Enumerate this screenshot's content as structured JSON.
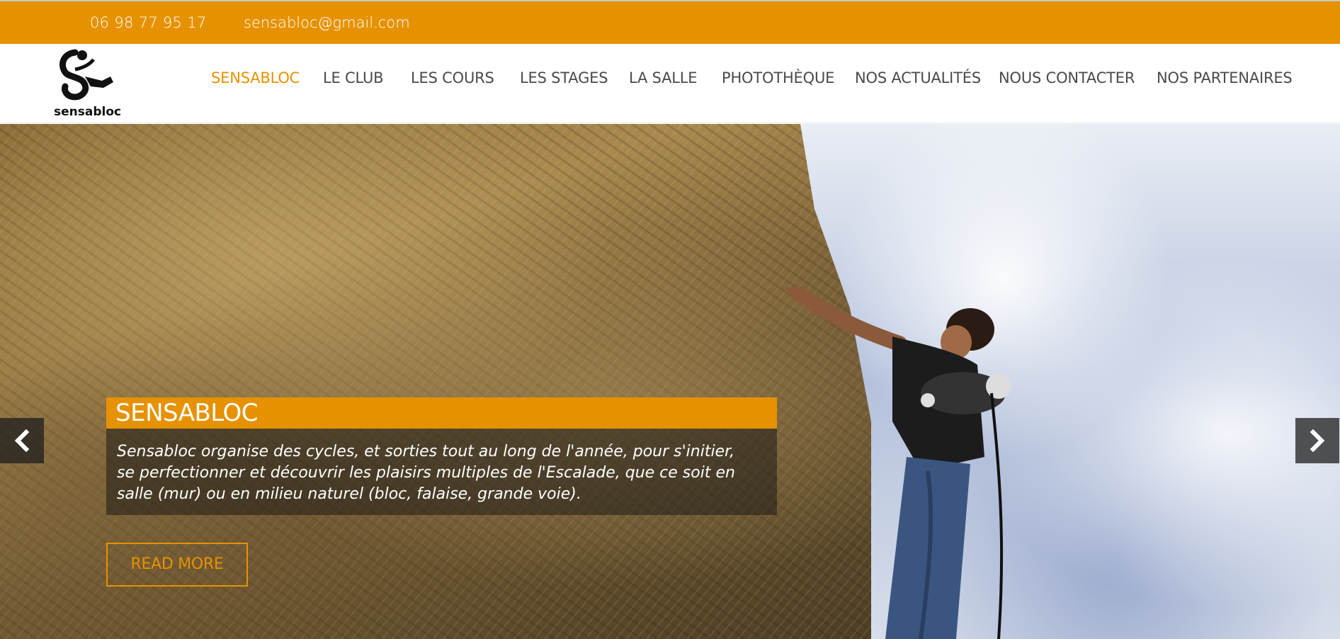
{
  "topbar": {
    "phone": "06 98 77 95 17",
    "email": "sensabloc@gmail.com"
  },
  "logo": {
    "text": "sensabloc",
    "icon": "climber-logo-icon"
  },
  "nav": {
    "items": [
      {
        "label": "SENSABLOC",
        "active": true
      },
      {
        "label": "LE CLUB"
      },
      {
        "label": "LES COURS"
      },
      {
        "label": "LES STAGES"
      },
      {
        "label": "LA SALLE"
      },
      {
        "label": "PHOTOTHÈQUE"
      },
      {
        "label": "NOS ACTUALITÉS"
      },
      {
        "label": "NOUS CONTACTER"
      },
      {
        "label": "NOS PARTENAIRES"
      }
    ]
  },
  "hero": {
    "title": "SENSABLOC",
    "text": "Sensabloc organise des cycles, et sorties tout au long de l'année, pour s'initier, se perfectionner et découvrir les plaisirs multiples de l'Escalade, que ce soit en salle (mur) ou en milieu naturel (bloc, falaise, grande voie).",
    "button": "READ MORE",
    "prev_icon": "chevron-left-icon",
    "next_icon": "chevron-right-icon"
  },
  "colors": {
    "accent": "#e69200",
    "nav_text": "#4a4a4a"
  }
}
